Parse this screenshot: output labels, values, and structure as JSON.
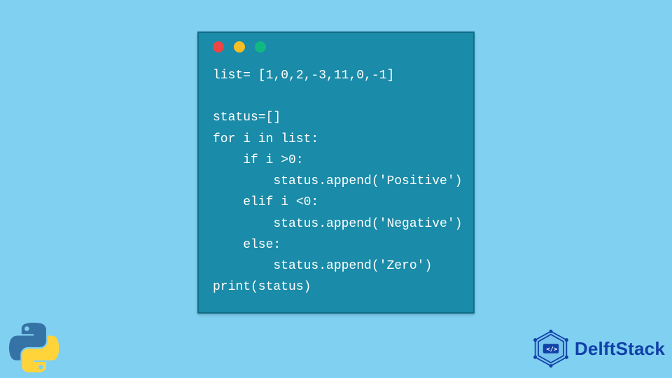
{
  "code": {
    "lines": [
      "list= [1,0,2,-3,11,0,-1]",
      "",
      "status=[]",
      "for i in list:",
      "    if i >0:",
      "        status.append('Positive')",
      "    elif i <0:",
      "        status.append('Negative')",
      "    else:",
      "        status.append('Zero')",
      "print(status)"
    ]
  },
  "brand": {
    "name": "DelftStack"
  },
  "colors": {
    "page_bg": "#80d0f2",
    "window_bg": "#1a8ba8",
    "window_border": "#0d6d86",
    "code_fg": "#ffffff",
    "dot_red": "#ef4444",
    "dot_yellow": "#fbbf24",
    "dot_green": "#10b981",
    "brand_fg": "#1040a8"
  }
}
